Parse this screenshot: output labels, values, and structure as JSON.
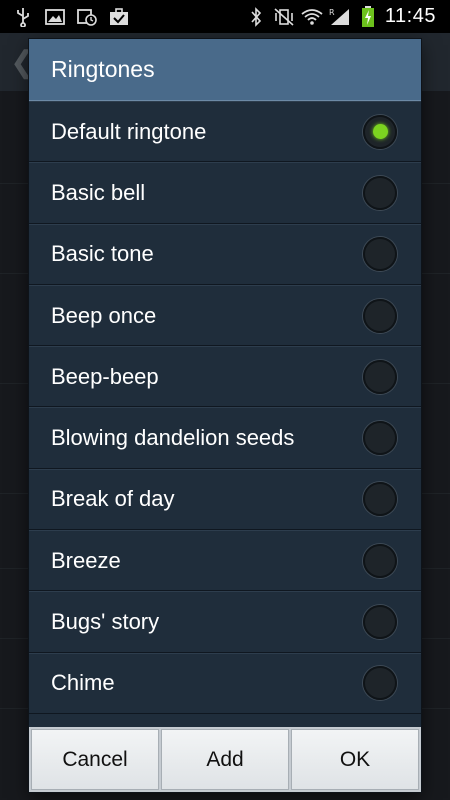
{
  "status_bar": {
    "time": "11:45",
    "left_icons": [
      "usb-icon",
      "image-icon",
      "calendar-clock-icon",
      "briefcase-check-icon"
    ],
    "right_icons": [
      "bluetooth-icon",
      "mute-vibrate-icon",
      "wifi-icon",
      "roaming-signal-icon",
      "battery-charging-icon"
    ]
  },
  "dialog": {
    "title": "Ringtones",
    "items": [
      {
        "label": "Default ringtone",
        "selected": true
      },
      {
        "label": "Basic bell",
        "selected": false
      },
      {
        "label": "Basic tone",
        "selected": false
      },
      {
        "label": "Beep once",
        "selected": false
      },
      {
        "label": "Beep-beep",
        "selected": false
      },
      {
        "label": "Blowing dandelion seeds",
        "selected": false
      },
      {
        "label": "Break of day",
        "selected": false
      },
      {
        "label": "Breeze",
        "selected": false
      },
      {
        "label": "Bugs' story",
        "selected": false
      },
      {
        "label": "Chime",
        "selected": false
      }
    ],
    "buttons": {
      "cancel": "Cancel",
      "add": "Add",
      "ok": "OK"
    }
  },
  "colors": {
    "title_bar": "#496a8a",
    "list_bg": "#1f2d3b",
    "radio_selected": "#7cd320"
  }
}
